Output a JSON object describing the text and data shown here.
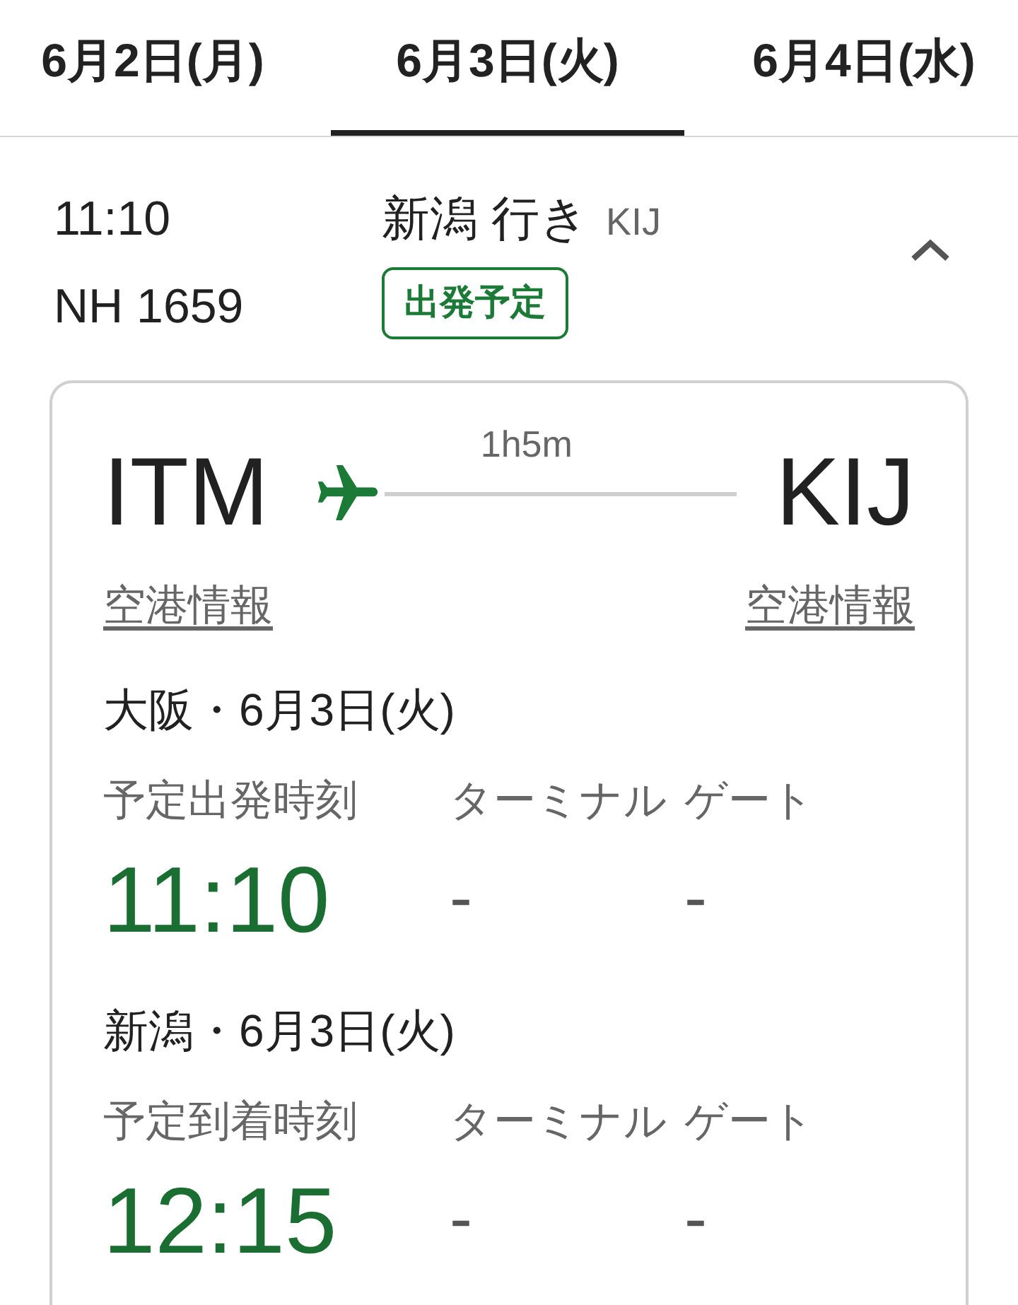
{
  "tabs": [
    {
      "label": "6月2日(月)",
      "selected": false
    },
    {
      "label": "6月3日(火)",
      "selected": true
    },
    {
      "label": "6月4日(水)",
      "selected": false
    }
  ],
  "flight": {
    "time": "11:10",
    "number": "NH 1659",
    "destination": "新潟 行き",
    "destination_code": "KIJ",
    "status": "出発予定",
    "expanded": true
  },
  "route": {
    "origin": "ITM",
    "destination": "KIJ",
    "duration": "1h5m",
    "origin_link": "空港情報",
    "destination_link": "空港情報"
  },
  "legs": [
    {
      "place_date": "大阪・6月3日(火)",
      "time_label": "予定出発時刻",
      "terminal_label": "ターミナル",
      "gate_label": "ゲート",
      "time": "11:10",
      "terminal": "-",
      "gate": "-"
    },
    {
      "place_date": "新潟・6月3日(火)",
      "time_label": "予定到着時刻",
      "terminal_label": "ターミナル",
      "gate_label": "ゲート",
      "time": "12:15",
      "terminal": "-",
      "gate": "-"
    }
  ]
}
